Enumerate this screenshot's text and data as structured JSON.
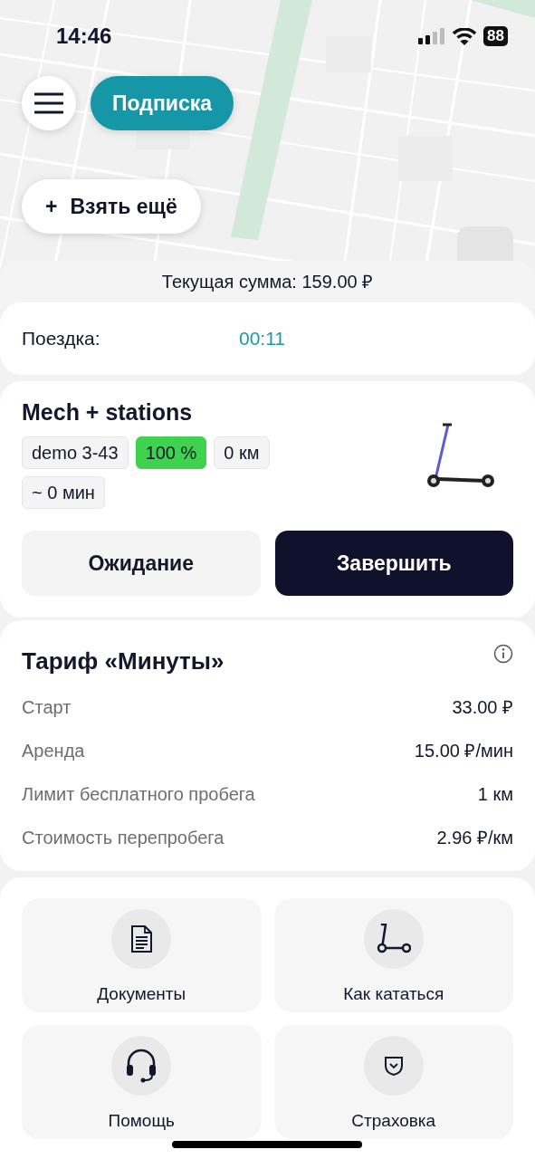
{
  "status_bar": {
    "time": "14:46",
    "battery": "88"
  },
  "map_buttons": {
    "subscription": "Подписка",
    "take_more": {
      "icon": "+",
      "label": "Взять ещё"
    }
  },
  "summary": "Текущая сумма: 159.00 ₽",
  "trip": {
    "label": "Поездка:",
    "timer": "00:11"
  },
  "vehicle": {
    "name": "Mech + stations",
    "tags": [
      {
        "text": "demo 3-43",
        "highlighted": false
      },
      {
        "text": "100 %",
        "highlighted": true
      },
      {
        "text": "0 км",
        "highlighted": false
      },
      {
        "text": "~ 0 мин",
        "highlighted": false
      }
    ]
  },
  "actions": [
    {
      "label": "Ожидание",
      "kind": "secondary"
    },
    {
      "label": "Завершить",
      "kind": "primary"
    }
  ],
  "tariff": {
    "title": "Тариф «Минуты»",
    "rows": [
      {
        "label": "Старт",
        "value": "33.00 ₽"
      },
      {
        "label": "Аренда",
        "value": "15.00 ₽/мин"
      },
      {
        "label": "Лимит бесплатного пробега",
        "value": "1 км"
      },
      {
        "label": "Стоимость перепробега",
        "value": "2.96 ₽/км"
      }
    ]
  },
  "menu": [
    {
      "label": "Документы",
      "kind": "document"
    },
    {
      "label": "Как кататься",
      "kind": "scooter"
    },
    {
      "label": "Помощь",
      "kind": "headset"
    },
    {
      "label": "Страховка",
      "kind": "shield"
    }
  ]
}
